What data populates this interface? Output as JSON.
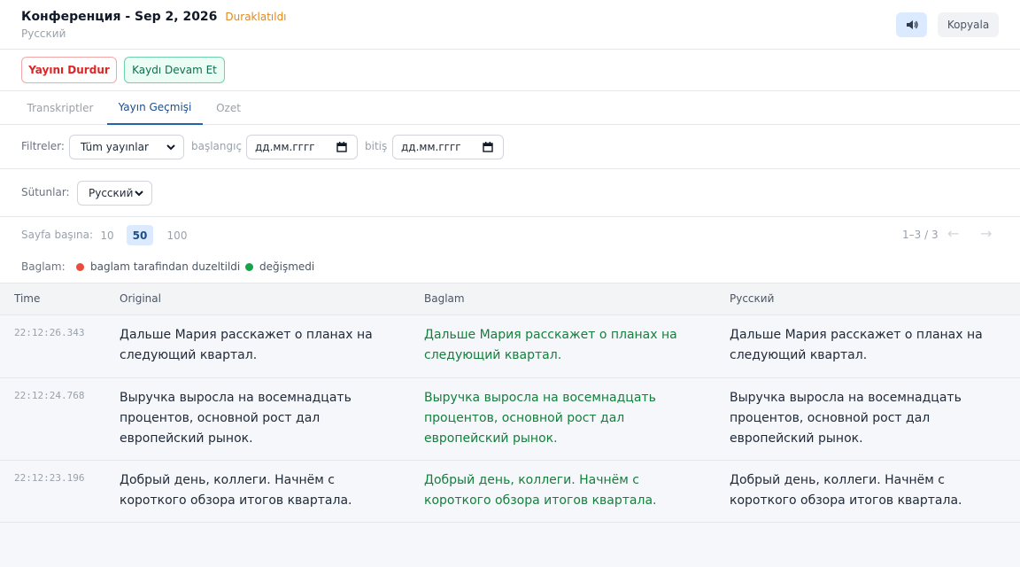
{
  "header": {
    "title": "Конференция - Sep 2, 2026",
    "status": "Duraklatıldı",
    "subtitle": "Русский",
    "speaker_icon": "speaker-icon",
    "copy_label": "Kopyala"
  },
  "actions": {
    "stop_label": "Yayını Durdur",
    "resume_label": "Kaydı Devam Et"
  },
  "tabs": [
    {
      "label": "Transkriptler",
      "active": false
    },
    {
      "label": "Yayın Geçmişi",
      "active": true
    },
    {
      "label": "Ozet",
      "active": false
    }
  ],
  "filters": {
    "label": "Filtreler:",
    "type_value": "Tüm yayınlar",
    "start_label": "başlangıç",
    "start_placeholder": "дд.мм.гггг",
    "end_label": "bitiş",
    "end_placeholder": "дд.мм.гггг"
  },
  "columns_selector": {
    "label": "Sütunlar:",
    "value": "Русский"
  },
  "paging": {
    "per_page_label": "Sayfa başına:",
    "options": [
      "10",
      "50",
      "100"
    ],
    "selected": "50",
    "info": "1–3 / 3",
    "prev": "←",
    "next": "→"
  },
  "legend": {
    "label": "Baglam:",
    "items": [
      {
        "label": "baglam tarafindan duzeltildi",
        "color": "#e74c3c"
      },
      {
        "label": "değişmedi",
        "color": "#16a34a"
      }
    ]
  },
  "table": {
    "headers": [
      "Time",
      "Original",
      "Baglam",
      "Русский"
    ],
    "rows": [
      {
        "time": "22:12:26.343",
        "original": "Дальше Мария расскажет о планах на следующий квартал.",
        "baglam": "Дальше Мария расскажет о планах на следующий квартал.",
        "russian": "Дальше Мария расскажет о планах на следующий квартал."
      },
      {
        "time": "22:12:24.768",
        "original": "Выручка выросла на восемнадцать процентов, основной рост дал европейский рынок.",
        "baglam": "Выручка выросла на восемнадцать процентов, основной рост дал европейский рынок.",
        "russian": "Выручка выросла на восемнадцать процентов, основной рост дал европейский рынок."
      },
      {
        "time": "22:12:23.196",
        "original": "Добрый день, коллеги. Начнём с короткого обзора итогов квартала.",
        "baglam": "Добрый день, коллеги. Начнём с короткого обзора итогов квартала.",
        "russian": "Добрый день, коллеги. Начнём с короткого обзора итогов квартала."
      }
    ]
  },
  "colors": {
    "accent": "#2563a8",
    "status": "#e08a1e",
    "danger": "#dc2626",
    "success": "#15803d"
  }
}
